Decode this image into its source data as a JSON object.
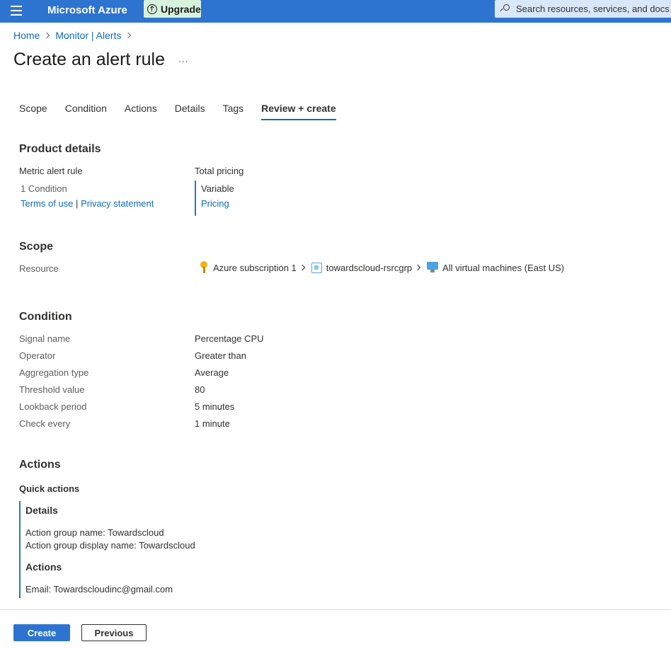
{
  "header": {
    "brand": "Microsoft Azure",
    "upgrade_label": "Upgrade",
    "search_placeholder": "Search resources, services, and docs (G"
  },
  "breadcrumb": [
    "Home",
    "Monitor | Alerts"
  ],
  "page": {
    "title": "Create an alert rule",
    "more": "..."
  },
  "tabs": [
    {
      "label": "Scope",
      "active": false
    },
    {
      "label": "Condition",
      "active": false
    },
    {
      "label": "Actions",
      "active": false
    },
    {
      "label": "Details",
      "active": false
    },
    {
      "label": "Tags",
      "active": false
    },
    {
      "label": "Review + create",
      "active": true
    }
  ],
  "product_details": {
    "heading": "Product details",
    "rule_type": "Metric alert rule",
    "condition_count": "1 Condition",
    "terms_link": "Terms of use",
    "separator": "|",
    "privacy_link": "Privacy statement",
    "pricing_label": "Total pricing",
    "pricing_value": "Variable",
    "pricing_link": "Pricing"
  },
  "scope": {
    "heading": "Scope",
    "resource_label": "Resource",
    "subscription": "Azure subscription 1",
    "resource_group": "towardscloud-rsrcgrp",
    "resource": "All virtual machines (East US)"
  },
  "condition": {
    "heading": "Condition",
    "rows": [
      {
        "label": "Signal name",
        "value": "Percentage CPU"
      },
      {
        "label": "Operator",
        "value": "Greater than"
      },
      {
        "label": "Aggregation type",
        "value": "Average"
      },
      {
        "label": "Threshold value",
        "value": "80"
      },
      {
        "label": "Lookback period",
        "value": "5 minutes"
      },
      {
        "label": "Check every",
        "value": "1 minute"
      }
    ]
  },
  "actions": {
    "heading": "Actions",
    "quick_actions": "Quick actions",
    "details_heading": "Details",
    "action_group_name": "Action group name: Towardscloud",
    "action_group_display_name": "Action group display name: Towardscloud",
    "actions_heading": "Actions",
    "email": "Email: Towardscloudinc@gmail.com"
  },
  "footer": {
    "create_label": "Create",
    "previous_label": "Previous"
  },
  "colors": {
    "accent": "#2d74d0",
    "link": "#0f6cbd",
    "upgrade_bg": "#d7f2dd"
  }
}
